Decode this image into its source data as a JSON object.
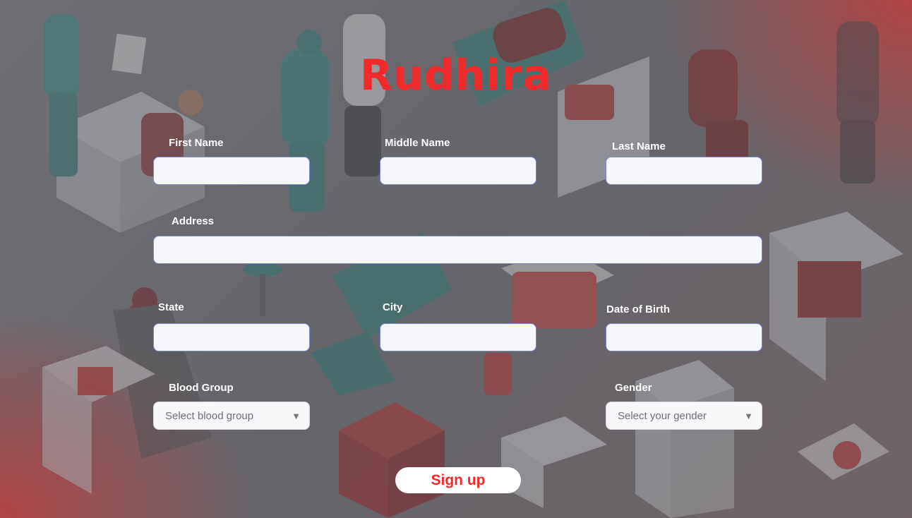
{
  "app": {
    "title": "Rudhira"
  },
  "form": {
    "first_name": {
      "label": "First Name",
      "value": ""
    },
    "middle_name": {
      "label": "Middle Name",
      "value": ""
    },
    "last_name": {
      "label": "Last Name",
      "value": ""
    },
    "address": {
      "label": "Address",
      "value": ""
    },
    "state": {
      "label": "State",
      "value": ""
    },
    "city": {
      "label": "City",
      "value": ""
    },
    "dob": {
      "label": "Date of Birth",
      "value": ""
    },
    "blood_group": {
      "label": "Blood Group",
      "selected": "Select blood group",
      "icon": "chevron-down-icon"
    },
    "gender": {
      "label": "Gender",
      "selected": "Select your gender",
      "icon": "chevron-down-icon"
    },
    "submit_label": "Sign up"
  },
  "colors": {
    "accent": "#ee2a2a",
    "field_border": "#7d8bd6",
    "field_bg": "#f5f7fd"
  }
}
